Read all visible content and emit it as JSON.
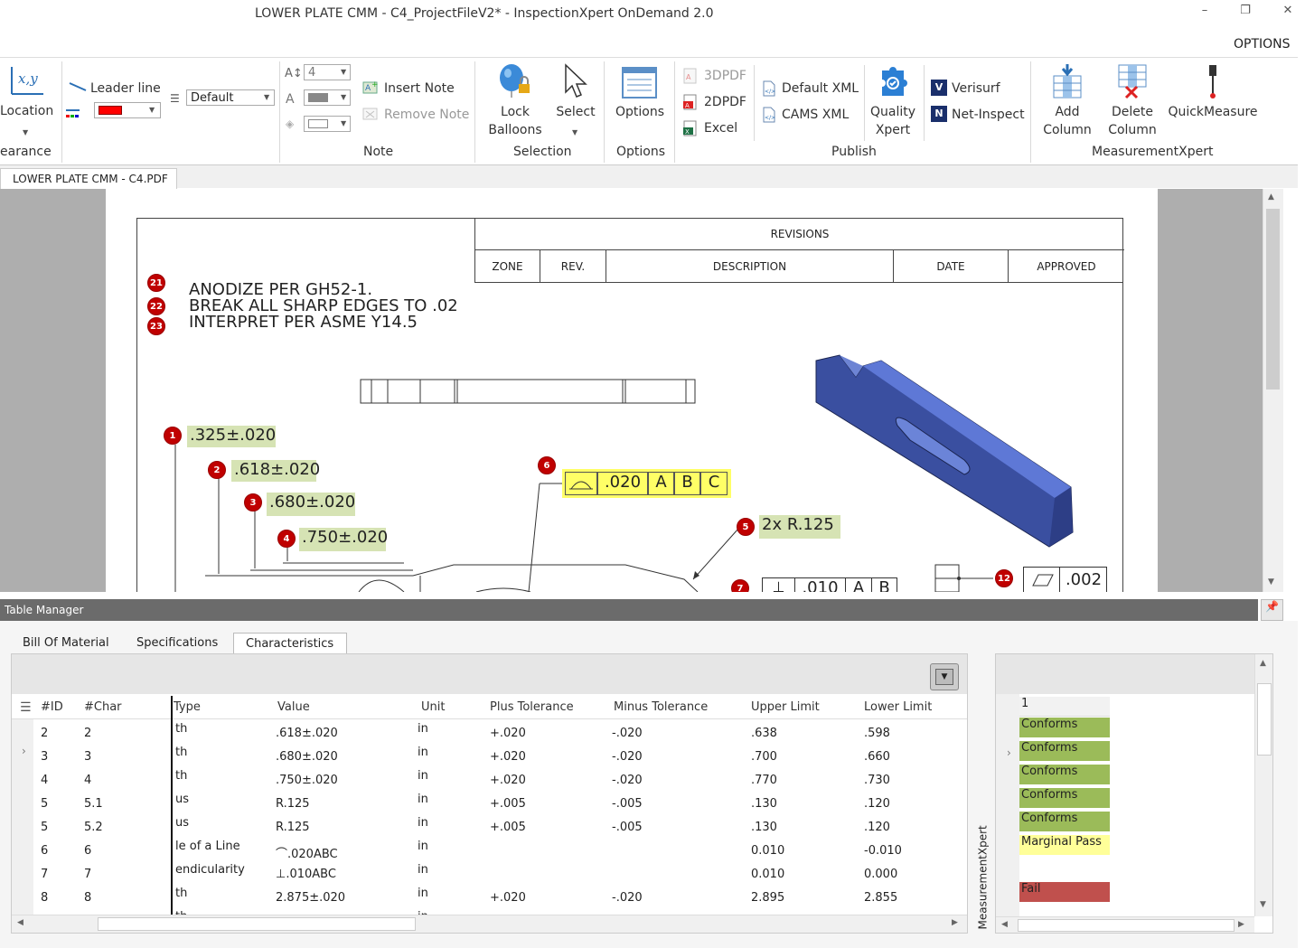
{
  "window": {
    "title": "LOWER PLATE CMM - C4_ProjectFileV2* - InspectionXpert OnDemand 2.0",
    "minimize_glyph": "–",
    "restore_glyph": "❐",
    "close_glyph": "✕",
    "options_label": "OPTIONS"
  },
  "ribbon": {
    "location_label": "Location",
    "location_icon_text": "x,y",
    "appearance_group": "earance",
    "leader_line_label": "Leader line",
    "style_combo": "Default",
    "font_size_combo": "4",
    "note_group": "Note",
    "insert_note": "Insert Note",
    "remove_note": "Remove Note",
    "lock_balloons_1": "Lock",
    "lock_balloons_2": "Balloons",
    "select": "Select",
    "selection_group": "Selection",
    "options_btn": "Options",
    "options_group": "Options",
    "pdf3d": "3DPDF",
    "pdf2d": "2DPDF",
    "excel": "Excel",
    "default_xml": "Default XML",
    "cams_xml": "CAMS XML",
    "quality_xpert_1": "Quality",
    "quality_xpert_2": "Xpert",
    "verisurf": "Verisurf",
    "net_inspect": "Net-Inspect",
    "publish_group": "Publish",
    "add_column_1": "Add",
    "add_column_2": "Column",
    "delete_column_1": "Delete",
    "delete_column_2": "Column",
    "quickmeasure": "QuickMeasure",
    "mx_group": "MeasurementXpert",
    "colors": {
      "leader_color": "#ff0000"
    }
  },
  "document_tab": "LOWER PLATE CMM - C4.PDF",
  "drawing": {
    "revisions_title": "REVISIONS",
    "rev_cols": [
      "ZONE",
      "REV.",
      "DESCRIPTION",
      "DATE",
      "APPROVED"
    ],
    "notes": [
      {
        "balloon": "21",
        "text": "ANODIZE PER GH52-1."
      },
      {
        "balloon": "22",
        "text": "BREAK ALL SHARP EDGES TO .02"
      },
      {
        "balloon": "23",
        "text": "INTERPRET PER ASME Y14.5"
      }
    ],
    "dims": [
      {
        "balloon": "1",
        "text": ".325±.020"
      },
      {
        "balloon": "2",
        "text": ".618±.020"
      },
      {
        "balloon": "3",
        "text": ".680±.020"
      },
      {
        "balloon": "4",
        "text": ".750±.020"
      },
      {
        "balloon": "5",
        "text": "2x R.125"
      },
      {
        "balloon": "6",
        "fcf": [
          ".020",
          "A",
          "B",
          "C"
        ]
      },
      {
        "balloon": "7",
        "fcf": [
          ".010",
          "A",
          "B"
        ]
      },
      {
        "balloon": "12",
        "fcf": [
          ".002"
        ]
      }
    ]
  },
  "table_manager": {
    "title": "Table Manager",
    "pin_glyph": "📌",
    "tabs": [
      "Bill Of Material",
      "Specifications",
      "Characteristics"
    ],
    "active_tab": "Characteristics",
    "columns": [
      "#ID",
      "#Char",
      "Type",
      "Value",
      "Unit",
      "Plus Tolerance",
      "Minus Tolerance",
      "Upper Limit",
      "Lower Limit"
    ],
    "rows": [
      {
        "id": "2",
        "char": "2",
        "type": "th",
        "value": ".618±.020",
        "unit": "in",
        "plus": "+.020",
        "minus": "-.020",
        "upper": ".638",
        "lower": ".598"
      },
      {
        "id": "3",
        "char": "3",
        "type": "th",
        "value": ".680±.020",
        "unit": "in",
        "plus": "+.020",
        "minus": "-.020",
        "upper": ".700",
        "lower": ".660"
      },
      {
        "id": "4",
        "char": "4",
        "type": "th",
        "value": ".750±.020",
        "unit": "in",
        "plus": "+.020",
        "minus": "-.020",
        "upper": ".770",
        "lower": ".730"
      },
      {
        "id": "5",
        "char": "5.1",
        "type": "us",
        "value": "R.125",
        "unit": "in",
        "plus": "+.005",
        "minus": "-.005",
        "upper": ".130",
        "lower": ".120"
      },
      {
        "id": "5",
        "char": "5.2",
        "type": "us",
        "value": "R.125",
        "unit": "in",
        "plus": "+.005",
        "minus": "-.005",
        "upper": ".130",
        "lower": ".120"
      },
      {
        "id": "6",
        "char": "6",
        "type": "le of a Line",
        "value": "⌒.020ABC",
        "unit": "in",
        "plus": "",
        "minus": "",
        "upper": "0.010",
        "lower": "-0.010"
      },
      {
        "id": "7",
        "char": "7",
        "type": "endicularity",
        "value": "⊥.010ABC",
        "unit": "in",
        "plus": "",
        "minus": "",
        "upper": "0.010",
        "lower": "0.000"
      },
      {
        "id": "8",
        "char": "8",
        "type": "th",
        "value": "2.875±.020",
        "unit": "in",
        "plus": "+.020",
        "minus": "-.020",
        "upper": "2.895",
        "lower": "2.855"
      },
      {
        "id": "",
        "char": "",
        "type": "th",
        "value": "",
        "unit": "in",
        "plus": "",
        "minus": "",
        "upper": "",
        "lower": ""
      }
    ],
    "mx_vertical_label": "MeasurementXpert",
    "mx_header": "1",
    "mx_results": [
      {
        "text": "Conforms",
        "color": "#9bbb59"
      },
      {
        "text": "Conforms",
        "color": "#9bbb59"
      },
      {
        "text": "Conforms",
        "color": "#9bbb59"
      },
      {
        "text": "Conforms",
        "color": "#9bbb59"
      },
      {
        "text": "Conforms",
        "color": "#9bbb59"
      },
      {
        "text": "Marginal Pass",
        "color": "#ffff99"
      },
      {
        "text": "",
        "color": "#ffffff"
      },
      {
        "text": "Fail",
        "color": "#c0504d"
      }
    ]
  }
}
